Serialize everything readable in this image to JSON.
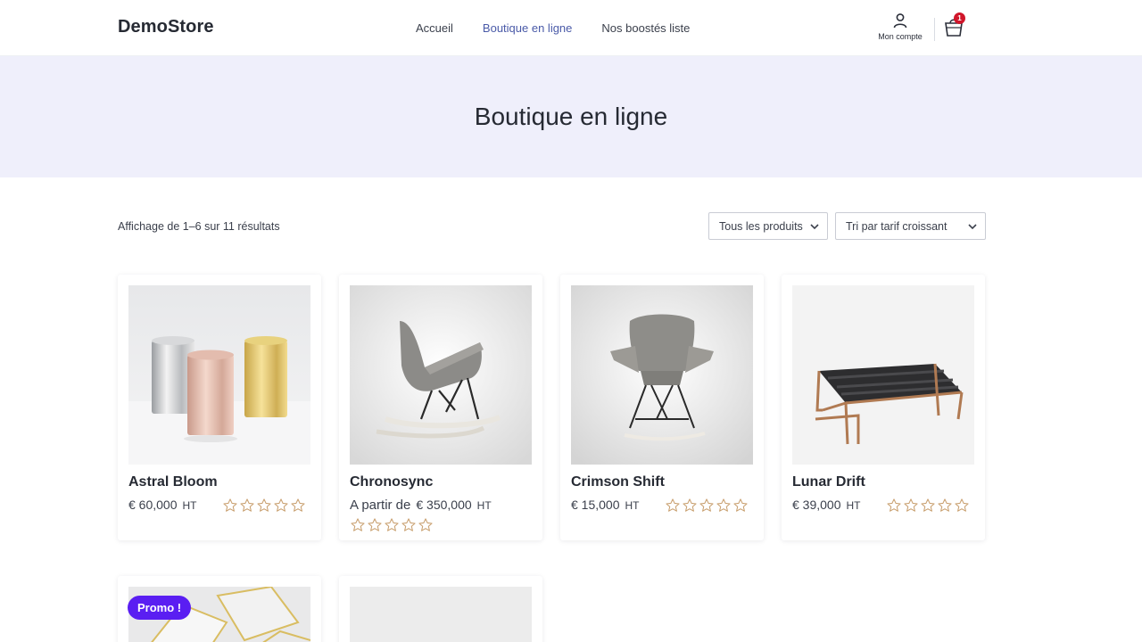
{
  "header": {
    "logo": "DemoStore",
    "nav": [
      {
        "label": "Accueil",
        "active": false
      },
      {
        "label": "Boutique en ligne",
        "active": true
      },
      {
        "label": "Nos boostés liste",
        "active": false
      }
    ],
    "account_label": "Mon compte",
    "cart_count": "1",
    "icons": {
      "account": "user-icon",
      "cart": "shopping-cart-icon"
    }
  },
  "hero": {
    "title": "Boutique en ligne"
  },
  "toolbar": {
    "result_count": "Affichage de 1–6 sur 11 résultats",
    "category_filter": "Tous les produits",
    "sort_order": "Tri par tarif croissant"
  },
  "products": [
    {
      "name": "Astral Bloom",
      "price_prefix": "",
      "price": "€ 60,000",
      "tax": "HT",
      "rating": 0,
      "rating_max": 5
    },
    {
      "name": "Chronosync",
      "price_prefix": "A partir de",
      "price": "€ 350,000",
      "tax": "HT",
      "rating": 0,
      "rating_max": 5
    },
    {
      "name": "Crimson Shift",
      "price_prefix": "",
      "price": "€ 15,000",
      "tax": "HT",
      "rating": 0,
      "rating_max": 5
    },
    {
      "name": "Lunar Drift",
      "price_prefix": "",
      "price": "€ 39,000",
      "tax": "HT",
      "rating": 0,
      "rating_max": 5
    }
  ],
  "promo_badge": "Promo !",
  "colors": {
    "accent": "#4a5aa8",
    "hero_bg": "#efeffb",
    "promo": "#5a1ef2",
    "cart_badge": "#d0162a",
    "star": "#c9a070"
  }
}
